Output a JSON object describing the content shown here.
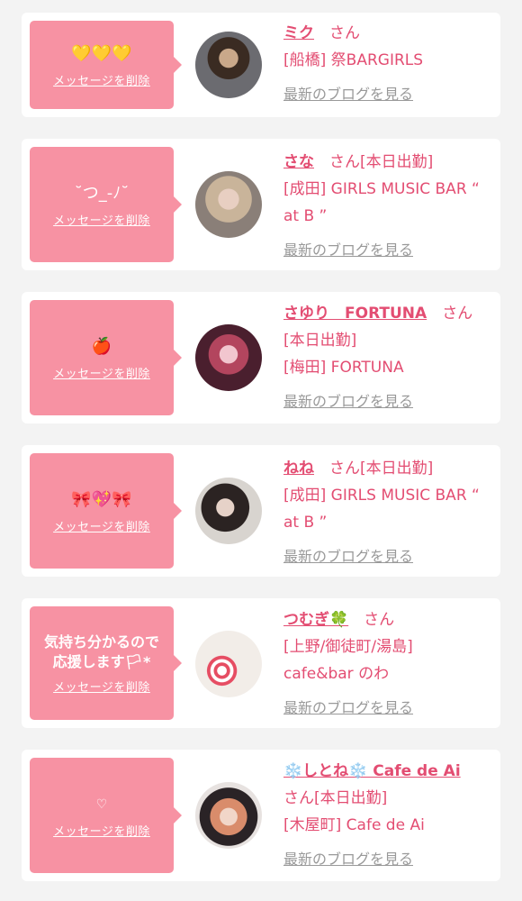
{
  "delete_label": "メッセージを削除",
  "blog_label": "最新のブログを見る",
  "honorific": "さん",
  "cards": [
    {
      "message": "💛💛💛",
      "name": "ミク",
      "status": "",
      "shop": "[船橋] 祭BARGIRLS"
    },
    {
      "message": "˘つ_-ﾉ˘",
      "name": "さな",
      "status": "[本日出勤]",
      "shop": "[成田] GIRLS MUSIC BAR “ at B ”"
    },
    {
      "message": "🍎",
      "name": "さゆり　FORTUNA",
      "status": "[本日出勤]",
      "shop": "[梅田] FORTUNA"
    },
    {
      "message": "🎀💖🎀",
      "name": "ねね",
      "status": "[本日出勤]",
      "shop": "[成田] GIRLS MUSIC BAR “ at B ”"
    },
    {
      "message": "気持ち分かるので応援します🏳*",
      "name": "つむぎ🍀",
      "status": "",
      "shop": "[上野/御徒町/湯島] cafe&bar のわ"
    },
    {
      "message": "♡",
      "name": "❄️しとね❄️ Cafe de Ai",
      "status": "[本日出勤]",
      "shop": "[木屋町] Cafe de Ai"
    }
  ]
}
